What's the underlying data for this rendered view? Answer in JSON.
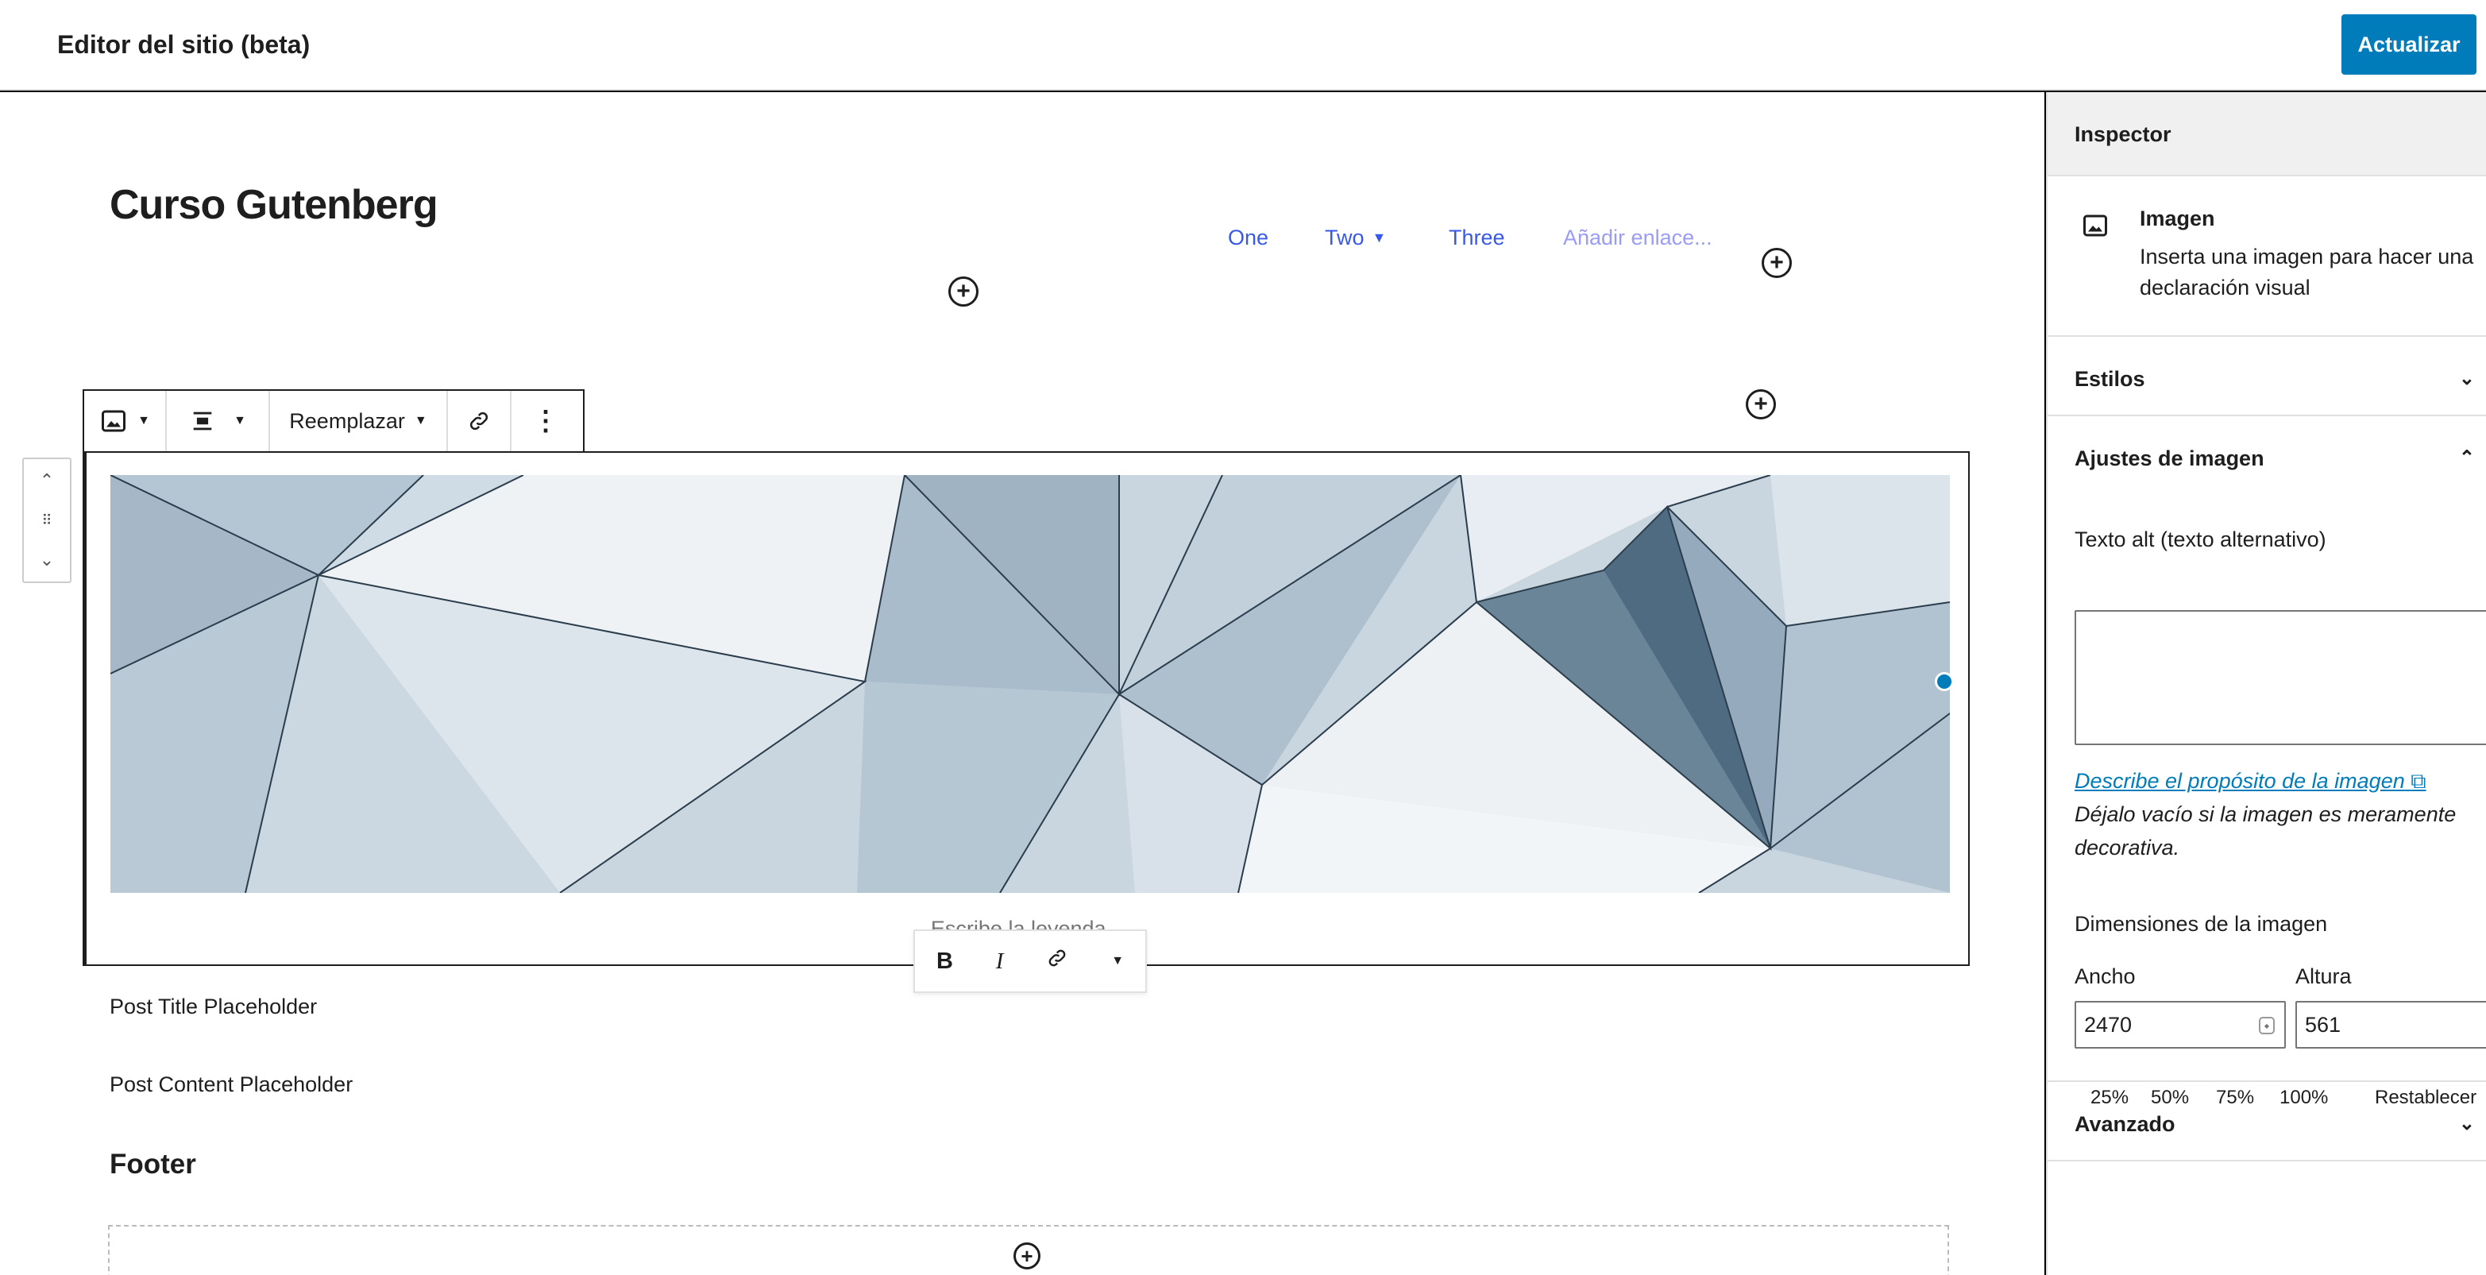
{
  "app": {
    "title": "Editor del sitio (beta)",
    "update_label": "Actualizar"
  },
  "site": {
    "title": "Curso Gutenberg"
  },
  "nav": {
    "items": [
      "One",
      "Two",
      "Three"
    ],
    "add_link": "Añadir enlace..."
  },
  "block_toolbar": {
    "replace_label": "Reemplazar"
  },
  "image_block": {
    "caption_placeholder": "Escribe la leyenda..."
  },
  "format_toolbar": {
    "bold": "B",
    "italic": "I"
  },
  "content": {
    "post_title": "Post Title Placeholder",
    "post_content": "Post Content Placeholder",
    "footer_heading": "Footer"
  },
  "sidebar": {
    "header": "Inspector",
    "block_card": {
      "title": "Imagen",
      "description": "Inserta una imagen para hacer una declaración visual"
    },
    "styles_label": "Estilos",
    "image_settings": {
      "title": "Ajustes de imagen",
      "alt_label": "Texto alt (texto alternativo)",
      "alt_value": "",
      "alt_link": "Describe el propósito de la imagen",
      "alt_help": "Déjalo vacío si la imagen es meramente decorativa.",
      "dimensions_label": "Dimensiones de la imagen",
      "width_label": "Ancho",
      "width_value": "2470",
      "height_label": "Altura",
      "height_value": "561",
      "percentages": [
        "25%",
        "50%",
        "75%",
        "100%"
      ],
      "reset_label": "Restablecer"
    },
    "advanced_label": "Avanzado"
  },
  "colors": {
    "accent": "#007cba",
    "nav_link": "#3858e9",
    "nav_add": "#9a9cf5"
  }
}
